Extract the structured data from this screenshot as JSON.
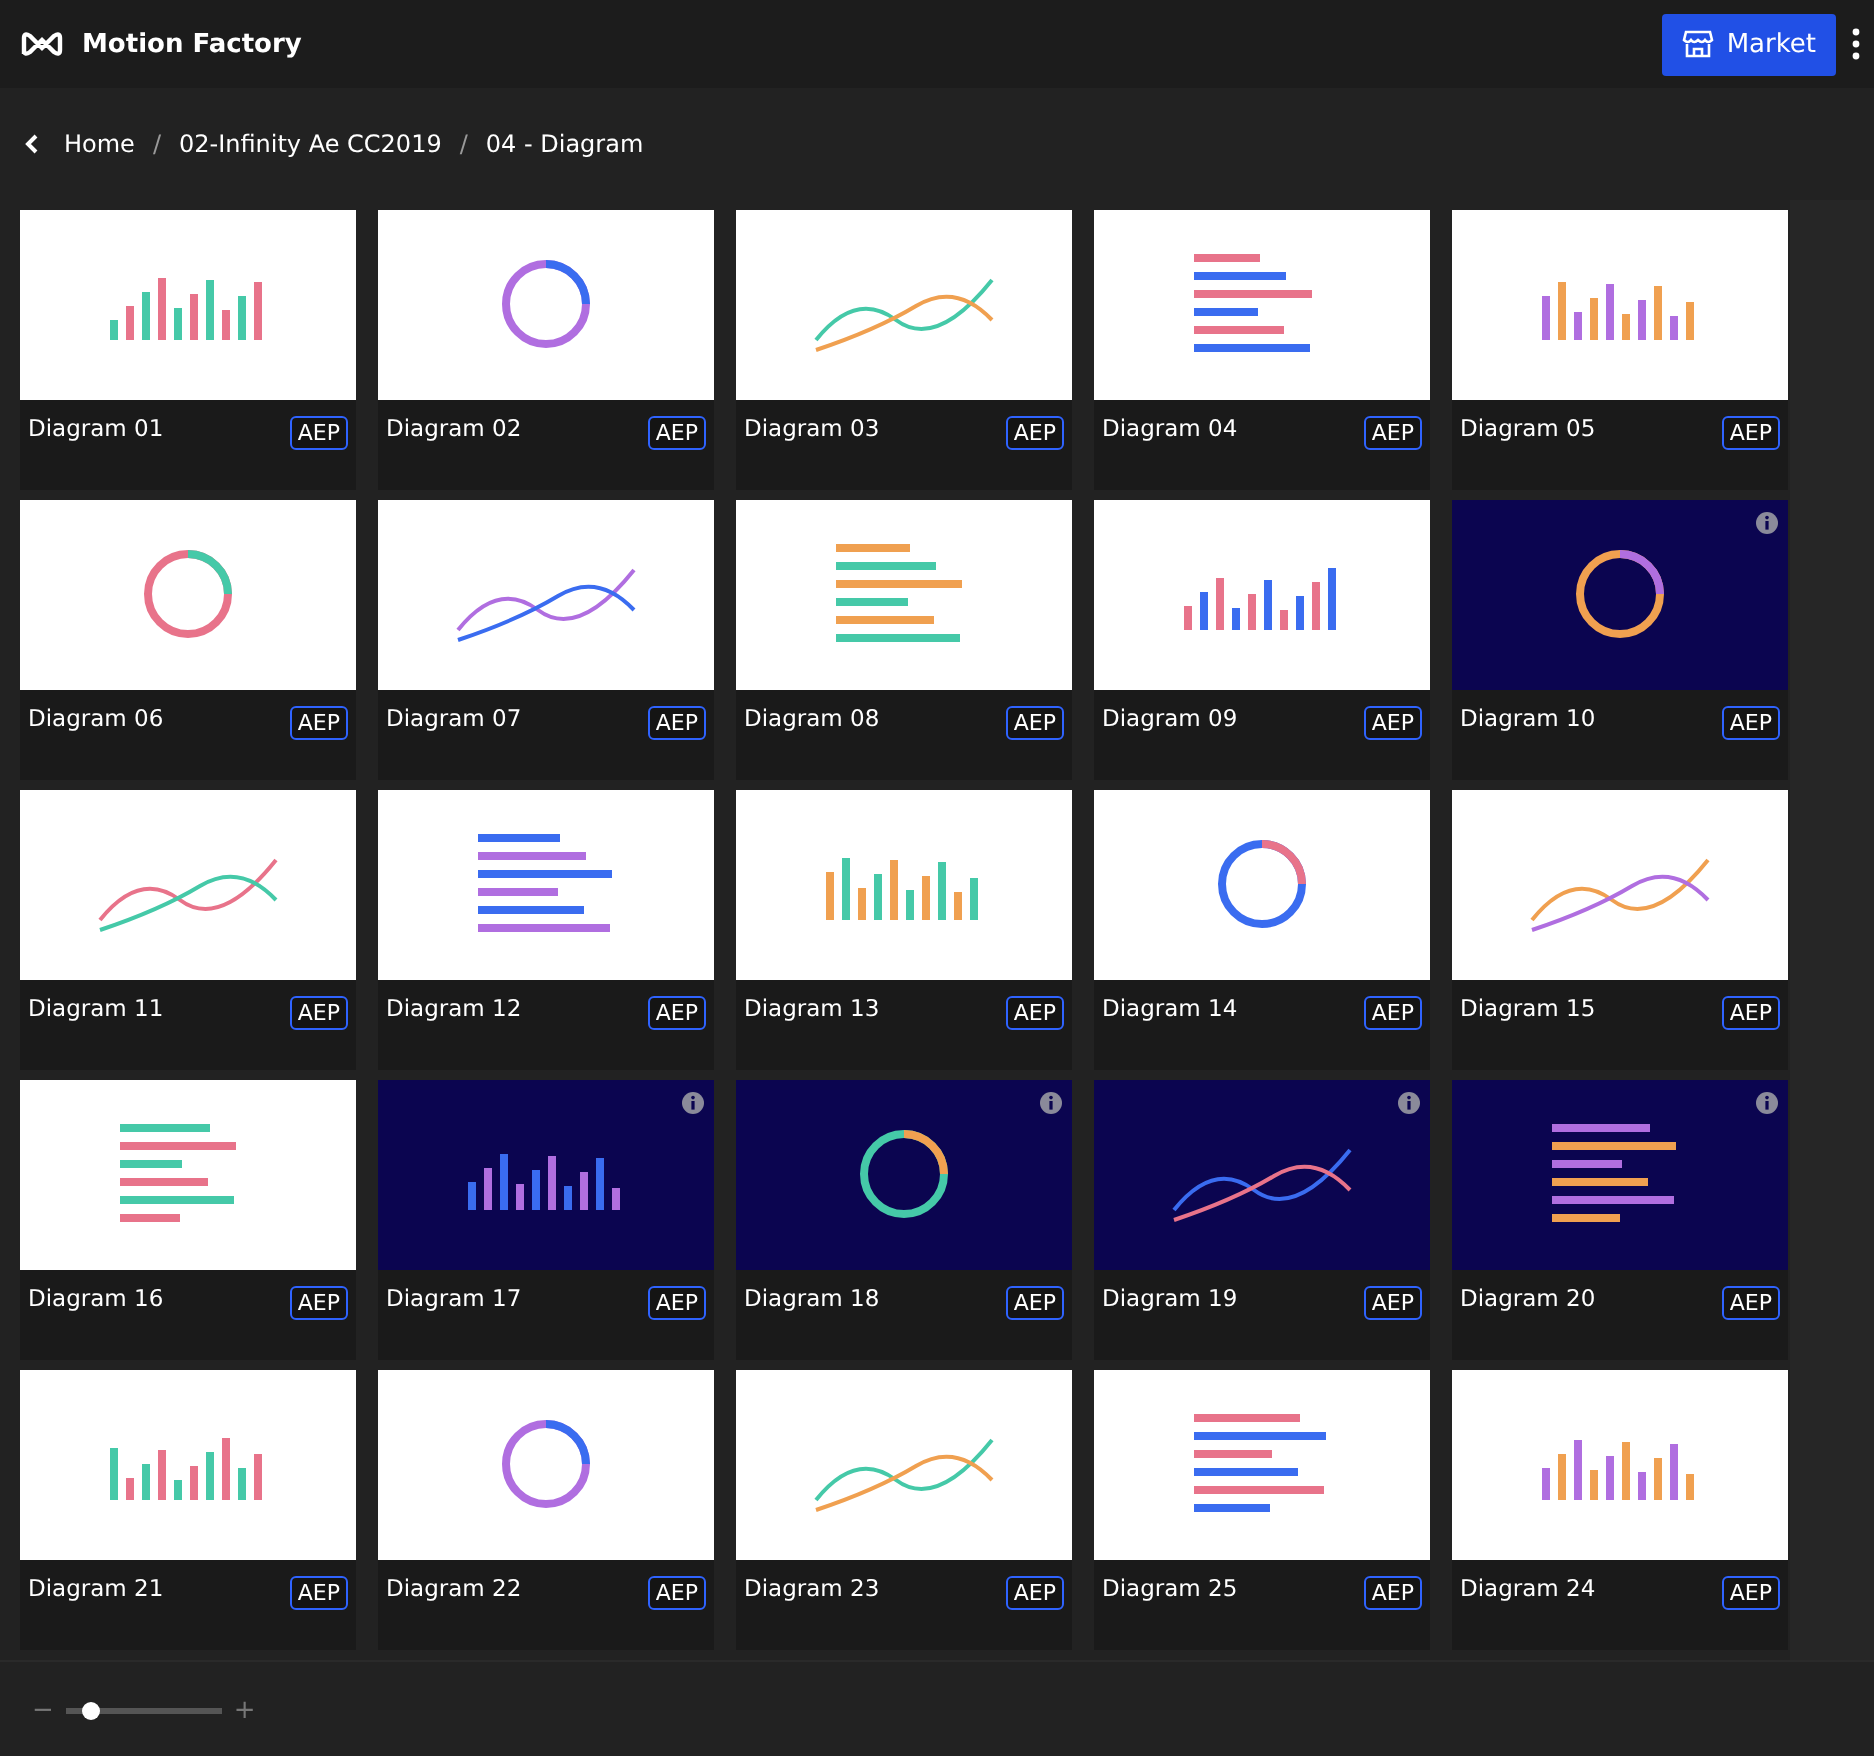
{
  "app": {
    "title": "Motion Factory",
    "market_button": "Market"
  },
  "breadcrumb": [
    "Home",
    "02-Infinity Ae CC2019",
    "04 - Diagram"
  ],
  "breadcrumb_separators": [
    "/",
    "/"
  ],
  "items": [
    {
      "title": "Diagram 01",
      "badge": "AEP",
      "info": false
    },
    {
      "title": "Diagram 02",
      "badge": "AEP",
      "info": false
    },
    {
      "title": "Diagram 03",
      "badge": "AEP",
      "info": false
    },
    {
      "title": "Diagram 04",
      "badge": "AEP",
      "info": false
    },
    {
      "title": "Diagram 05",
      "badge": "AEP",
      "info": false
    },
    {
      "title": "Diagram 06",
      "badge": "AEP",
      "info": false
    },
    {
      "title": "Diagram 07",
      "badge": "AEP",
      "info": false
    },
    {
      "title": "Diagram 08",
      "badge": "AEP",
      "info": false
    },
    {
      "title": "Diagram 09",
      "badge": "AEP",
      "info": false
    },
    {
      "title": "Diagram 10",
      "badge": "AEP",
      "info": true
    },
    {
      "title": "Diagram 11",
      "badge": "AEP",
      "info": false
    },
    {
      "title": "Diagram 12",
      "badge": "AEP",
      "info": false
    },
    {
      "title": "Diagram 13",
      "badge": "AEP",
      "info": false
    },
    {
      "title": "Diagram 14",
      "badge": "AEP",
      "info": false
    },
    {
      "title": "Diagram 15",
      "badge": "AEP",
      "info": false
    },
    {
      "title": "Diagram 16",
      "badge": "AEP",
      "info": false
    },
    {
      "title": "Diagram 17",
      "badge": "AEP",
      "info": true
    },
    {
      "title": "Diagram 18",
      "badge": "AEP",
      "info": true
    },
    {
      "title": "Diagram 19",
      "badge": "AEP",
      "info": true
    },
    {
      "title": "Diagram 20",
      "badge": "AEP",
      "info": true
    },
    {
      "title": "Diagram 21",
      "badge": "AEP",
      "info": false
    },
    {
      "title": "Diagram 22",
      "badge": "AEP",
      "info": false
    },
    {
      "title": "Diagram 23",
      "badge": "AEP",
      "info": false
    },
    {
      "title": "Diagram 25",
      "badge": "AEP",
      "info": false
    },
    {
      "title": "Diagram 24",
      "badge": "AEP",
      "info": false
    }
  ],
  "zoom": {
    "minus": "−",
    "plus": "+",
    "level": 0.15
  }
}
